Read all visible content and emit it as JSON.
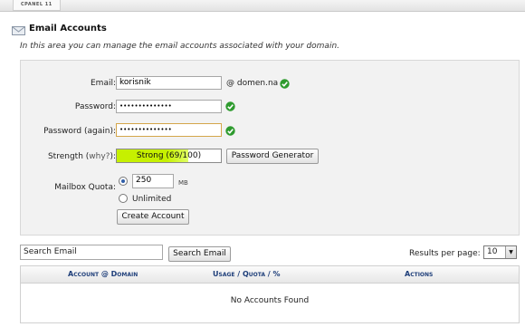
{
  "header": {
    "tab_label": "CPANEL 11"
  },
  "page": {
    "icon": "mail-icon",
    "title": "Email Accounts",
    "description": "In this area you can manage the email accounts associated with your domain."
  },
  "form": {
    "email_label": "Email:",
    "email_value": "korisnik",
    "domain": "@ domen.na",
    "password_label": "Password:",
    "password_value": "••••••••••••••",
    "password_again_label": "Password (again):",
    "password_again_value": "••••••••••••••",
    "strength_label": "Strength (",
    "strength_why": "why?",
    "strength_label_end": "):",
    "strength_text": "Strong (69/100)",
    "strength_score": 69,
    "strength_color": "#c6f000",
    "password_generator_label": "Password Generator",
    "quota_label": "Mailbox Quota:",
    "quota_value": "250",
    "quota_unit": "MB",
    "quota_selected": "limited",
    "unlimited_label": "Unlimited",
    "create_button_label": "Create Account",
    "valid_icon": "check-circle-icon",
    "valid_color": "#2e9b2e"
  },
  "search": {
    "placeholder": "Search Email",
    "button_label": "Search Email",
    "results_per_page_label": "Results per page:",
    "results_per_page_value": "10"
  },
  "table": {
    "columns": [
      "Account @ Domain",
      "Usage / Quota / %",
      "Actions"
    ],
    "empty_message": "No Accounts Found"
  }
}
